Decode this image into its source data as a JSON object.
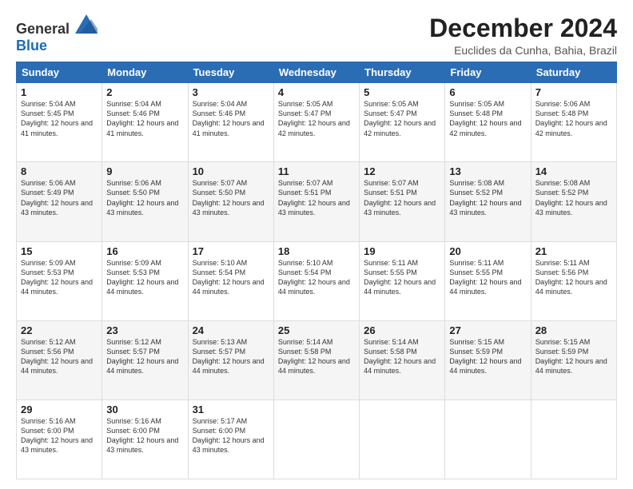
{
  "logo": {
    "general": "General",
    "blue": "Blue"
  },
  "title": "December 2024",
  "subtitle": "Euclides da Cunha, Bahia, Brazil",
  "headers": [
    "Sunday",
    "Monday",
    "Tuesday",
    "Wednesday",
    "Thursday",
    "Friday",
    "Saturday"
  ],
  "weeks": [
    [
      {
        "day": "1",
        "sunrise": "5:04 AM",
        "sunset": "5:45 PM",
        "daylight": "12 hours and 41 minutes."
      },
      {
        "day": "2",
        "sunrise": "5:04 AM",
        "sunset": "5:46 PM",
        "daylight": "12 hours and 41 minutes."
      },
      {
        "day": "3",
        "sunrise": "5:04 AM",
        "sunset": "5:46 PM",
        "daylight": "12 hours and 41 minutes."
      },
      {
        "day": "4",
        "sunrise": "5:05 AM",
        "sunset": "5:47 PM",
        "daylight": "12 hours and 42 minutes."
      },
      {
        "day": "5",
        "sunrise": "5:05 AM",
        "sunset": "5:47 PM",
        "daylight": "12 hours and 42 minutes."
      },
      {
        "day": "6",
        "sunrise": "5:05 AM",
        "sunset": "5:48 PM",
        "daylight": "12 hours and 42 minutes."
      },
      {
        "day": "7",
        "sunrise": "5:06 AM",
        "sunset": "5:48 PM",
        "daylight": "12 hours and 42 minutes."
      }
    ],
    [
      {
        "day": "8",
        "sunrise": "5:06 AM",
        "sunset": "5:49 PM",
        "daylight": "12 hours and 43 minutes."
      },
      {
        "day": "9",
        "sunrise": "5:06 AM",
        "sunset": "5:50 PM",
        "daylight": "12 hours and 43 minutes."
      },
      {
        "day": "10",
        "sunrise": "5:07 AM",
        "sunset": "5:50 PM",
        "daylight": "12 hours and 43 minutes."
      },
      {
        "day": "11",
        "sunrise": "5:07 AM",
        "sunset": "5:51 PM",
        "daylight": "12 hours and 43 minutes."
      },
      {
        "day": "12",
        "sunrise": "5:07 AM",
        "sunset": "5:51 PM",
        "daylight": "12 hours and 43 minutes."
      },
      {
        "day": "13",
        "sunrise": "5:08 AM",
        "sunset": "5:52 PM",
        "daylight": "12 hours and 43 minutes."
      },
      {
        "day": "14",
        "sunrise": "5:08 AM",
        "sunset": "5:52 PM",
        "daylight": "12 hours and 43 minutes."
      }
    ],
    [
      {
        "day": "15",
        "sunrise": "5:09 AM",
        "sunset": "5:53 PM",
        "daylight": "12 hours and 44 minutes."
      },
      {
        "day": "16",
        "sunrise": "5:09 AM",
        "sunset": "5:53 PM",
        "daylight": "12 hours and 44 minutes."
      },
      {
        "day": "17",
        "sunrise": "5:10 AM",
        "sunset": "5:54 PM",
        "daylight": "12 hours and 44 minutes."
      },
      {
        "day": "18",
        "sunrise": "5:10 AM",
        "sunset": "5:54 PM",
        "daylight": "12 hours and 44 minutes."
      },
      {
        "day": "19",
        "sunrise": "5:11 AM",
        "sunset": "5:55 PM",
        "daylight": "12 hours and 44 minutes."
      },
      {
        "day": "20",
        "sunrise": "5:11 AM",
        "sunset": "5:55 PM",
        "daylight": "12 hours and 44 minutes."
      },
      {
        "day": "21",
        "sunrise": "5:11 AM",
        "sunset": "5:56 PM",
        "daylight": "12 hours and 44 minutes."
      }
    ],
    [
      {
        "day": "22",
        "sunrise": "5:12 AM",
        "sunset": "5:56 PM",
        "daylight": "12 hours and 44 minutes."
      },
      {
        "day": "23",
        "sunrise": "5:12 AM",
        "sunset": "5:57 PM",
        "daylight": "12 hours and 44 minutes."
      },
      {
        "day": "24",
        "sunrise": "5:13 AM",
        "sunset": "5:57 PM",
        "daylight": "12 hours and 44 minutes."
      },
      {
        "day": "25",
        "sunrise": "5:14 AM",
        "sunset": "5:58 PM",
        "daylight": "12 hours and 44 minutes."
      },
      {
        "day": "26",
        "sunrise": "5:14 AM",
        "sunset": "5:58 PM",
        "daylight": "12 hours and 44 minutes."
      },
      {
        "day": "27",
        "sunrise": "5:15 AM",
        "sunset": "5:59 PM",
        "daylight": "12 hours and 44 minutes."
      },
      {
        "day": "28",
        "sunrise": "5:15 AM",
        "sunset": "5:59 PM",
        "daylight": "12 hours and 44 minutes."
      }
    ],
    [
      {
        "day": "29",
        "sunrise": "5:16 AM",
        "sunset": "6:00 PM",
        "daylight": "12 hours and 43 minutes."
      },
      {
        "day": "30",
        "sunrise": "5:16 AM",
        "sunset": "6:00 PM",
        "daylight": "12 hours and 43 minutes."
      },
      {
        "day": "31",
        "sunrise": "5:17 AM",
        "sunset": "6:00 PM",
        "daylight": "12 hours and 43 minutes."
      },
      null,
      null,
      null,
      null
    ]
  ],
  "labels": {
    "sunrise": "Sunrise: ",
    "sunset": "Sunset: ",
    "daylight": "Daylight: "
  }
}
